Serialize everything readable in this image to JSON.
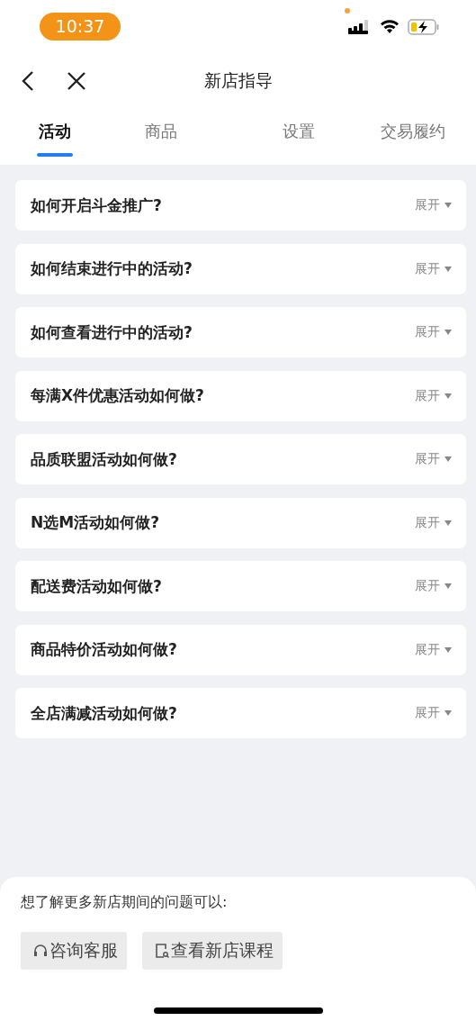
{
  "status_bar": {
    "time": "10:37"
  },
  "nav": {
    "title": "新店指导"
  },
  "tabs": [
    {
      "label": "活动",
      "selected": true
    },
    {
      "label": "商品",
      "selected": false
    },
    {
      "label": "设置",
      "selected": false
    },
    {
      "label": "交易履约",
      "selected": false
    }
  ],
  "faq": [
    {
      "question": "如何开启斗金推广?",
      "toggle": "展开",
      "expanded": false
    },
    {
      "question": "如何结束进行中的活动?",
      "toggle": "展开",
      "expanded": false
    },
    {
      "question": "如何查看进行中的活动?",
      "toggle": "展开",
      "expanded": false
    },
    {
      "question": "每满X件优惠活动如何做?",
      "toggle": "展开",
      "expanded": false
    },
    {
      "question": "品质联盟活动如何做?",
      "toggle": "展开",
      "expanded": false
    },
    {
      "question": "N选M活动如何做?",
      "toggle": "展开",
      "expanded": false
    },
    {
      "question": "配送费活动如何做?",
      "toggle": "展开",
      "expanded": false
    },
    {
      "question": "商品特价活动如何做?",
      "toggle": "展开",
      "expanded": false
    },
    {
      "question": "全店满减活动如何做?",
      "toggle": "展开",
      "expanded": false
    }
  ],
  "footer": {
    "prompt": "想了解更多新店期间的问题可以:",
    "buttons": [
      {
        "kind": "service",
        "label": "咨询客服"
      },
      {
        "kind": "course",
        "label": "查看新店课程"
      }
    ]
  }
}
